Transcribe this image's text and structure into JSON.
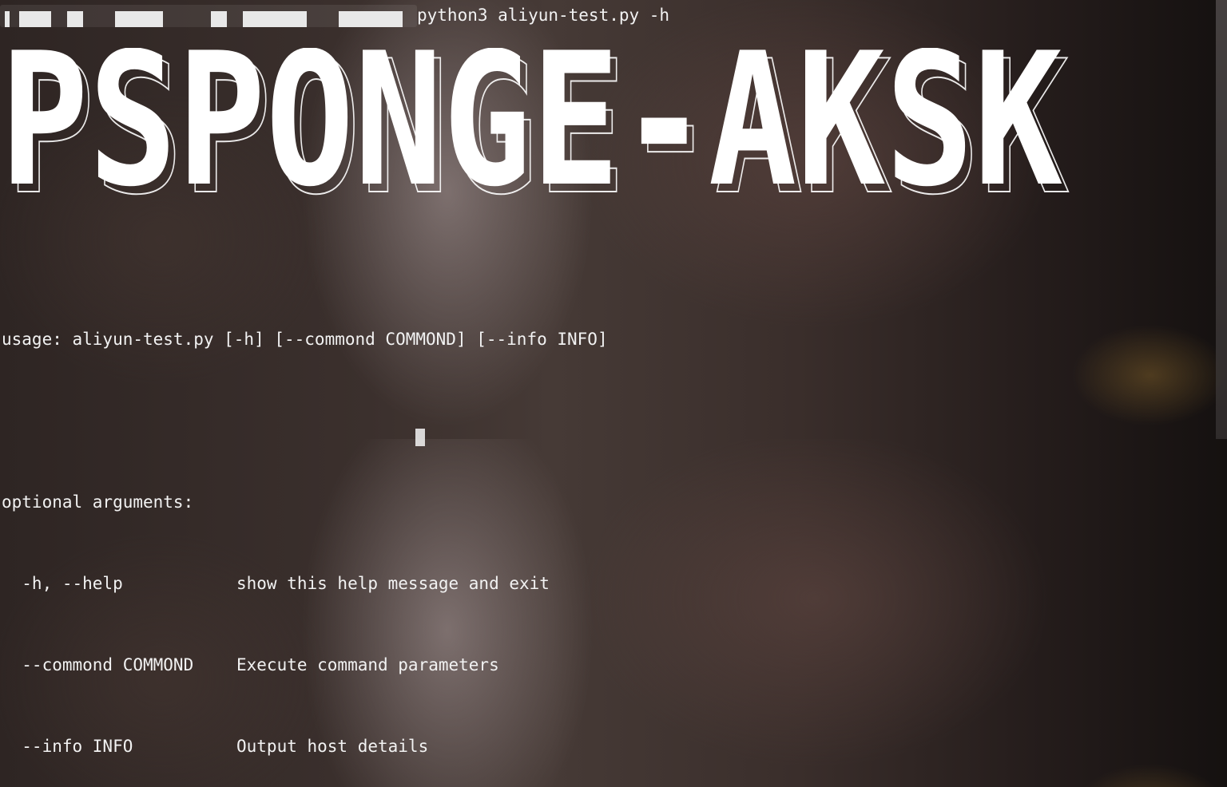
{
  "terminal": {
    "command": "python3 aliyun-test.py -h",
    "banner": "PSPONGE-AKSK",
    "usage": "usage: aliyun-test.py [-h] [--commond COMMOND] [--info INFO]",
    "section_heading": "optional arguments:",
    "options": [
      {
        "flag": "  -h, --help",
        "description": "show this help message and exit"
      },
      {
        "flag": "  --commond COMMOND",
        "description": "Execute command parameters"
      },
      {
        "flag": "  --info INFO",
        "description": "Output host details"
      }
    ]
  },
  "colors": {
    "text": "#f2f2f2",
    "background": "#3a2e2b"
  }
}
